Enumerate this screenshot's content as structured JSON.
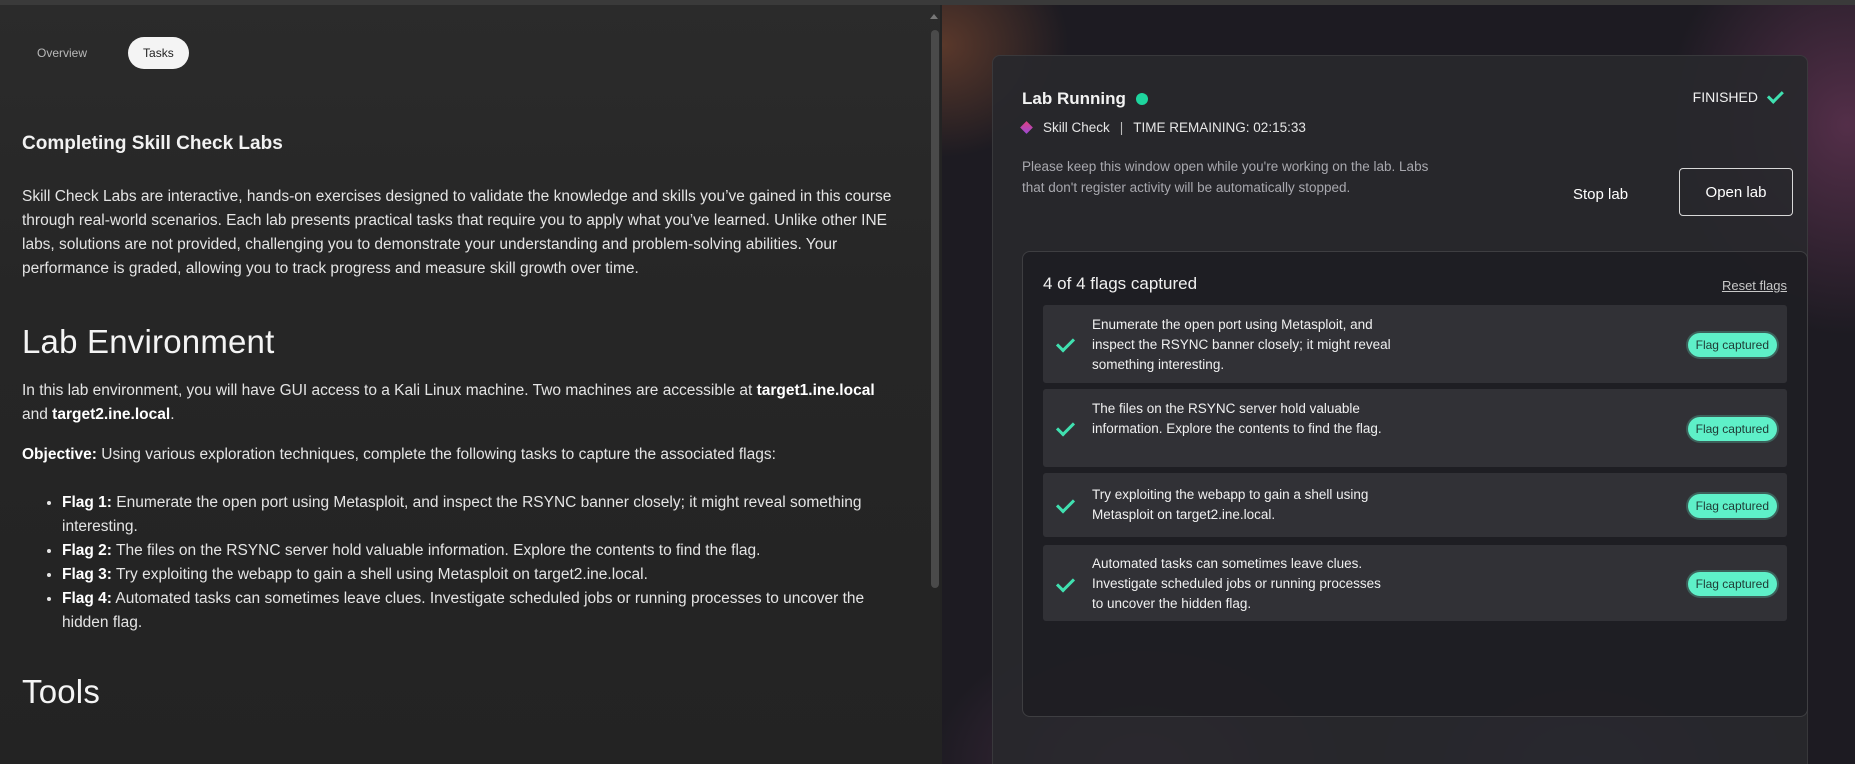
{
  "tabs": [
    {
      "label": "Overview"
    },
    {
      "label": "Tasks"
    }
  ],
  "content": {
    "section1_title": "Completing Skill Check Labs",
    "section1_body": "Skill Check Labs are interactive, hands-on exercises designed to validate the knowledge and skills you’ve gained in this course through real-world scenarios. Each lab presents practical tasks that require you to apply what you’ve learned. Unlike other INE labs, solutions are not provided, challenging you to demonstrate your understanding and problem-solving abilities. Your performance is graded, allowing you to track progress and measure skill growth over time.",
    "lab_env_title": "Lab Environment",
    "lab_env_p1_prefix": "In this lab environment, you will have GUI access to a Kali Linux machine. Two machines are accessible at ",
    "target1": "target1.ine.local",
    "lab_env_p1_and": "and ",
    "target2": "target2.ine.local",
    "lab_env_p1_suffix": ".",
    "objective_label": "Objective:",
    "objective_text": " Using various exploration techniques, complete the following tasks to capture the associated flags:",
    "flags": [
      {
        "label": "Flag 1:",
        "text": " Enumerate the open port using Metasploit, and inspect the RSYNC banner closely; it might reveal something interesting."
      },
      {
        "label": "Flag 2:",
        "text": " The files on the RSYNC server hold valuable information. Explore the contents to find the flag."
      },
      {
        "label": "Flag 3:",
        "text": " Try exploiting the webapp to gain a shell using Metasploit on target2.ine.local."
      },
      {
        "label": "Flag 4:",
        "text": " Automated tasks can sometimes leave clues. Investigate scheduled jobs or running processes to uncover the hidden flag."
      }
    ],
    "tools_title": "Tools"
  },
  "lab": {
    "status_title": "Lab Running",
    "skill_label": "Skill Check",
    "separator": "|",
    "time_remaining": "TIME REMAINING: 02:15:33",
    "finished_label": "FINISHED",
    "info_text": "Please keep this window open while you're working on the lab. Labs that don't register activity will be automatically stopped.",
    "stop_label": "Stop lab",
    "open_label": "Open lab",
    "flags_count": "4 of 4 flags captured",
    "reset_label": "Reset flags",
    "status_color": "#1ed59e",
    "badge_color": "#5ef0c8",
    "items": [
      {
        "text": "Enumerate the open port using Metasploit, and inspect the RSYNC banner closely; it might reveal something interesting.",
        "badge": "Flag captured"
      },
      {
        "text": "The files on the RSYNC server hold valuable information. Explore the contents to find the flag.",
        "badge": "Flag captured"
      },
      {
        "text": "Try exploiting the webapp to gain a shell using Metasploit on target2.ine.local.",
        "badge": "Flag captured"
      },
      {
        "text": "Automated tasks can sometimes leave clues. Investigate scheduled jobs or running processes to uncover the hidden flag.",
        "badge": "Flag captured"
      }
    ]
  }
}
